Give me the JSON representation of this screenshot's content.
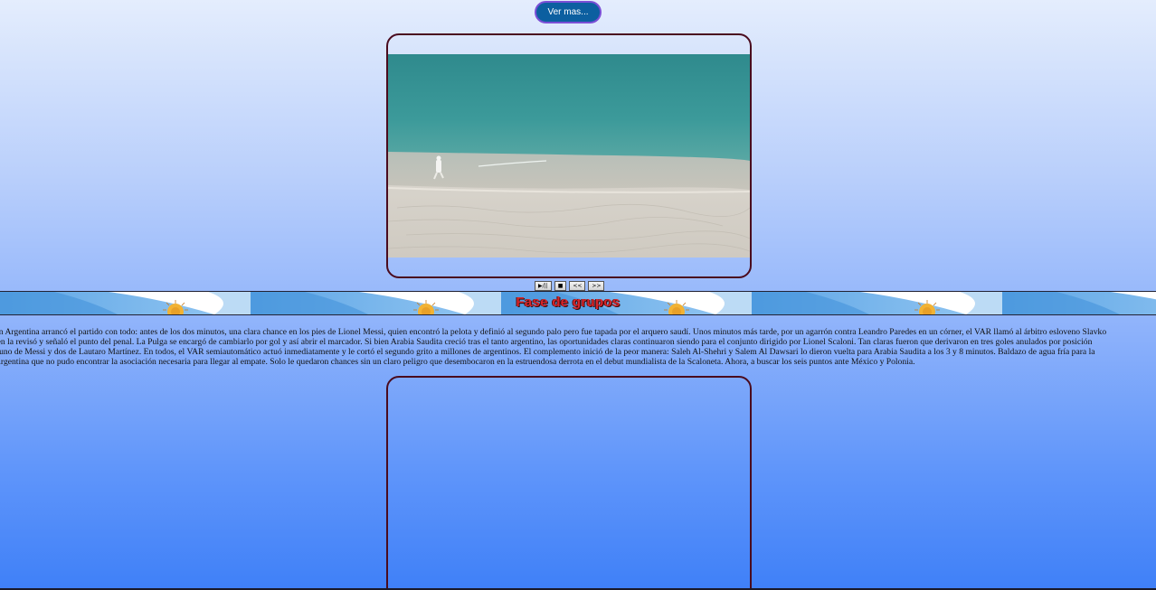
{
  "header": {
    "ver_mas_label": "Ver mas..."
  },
  "video_controls": {
    "play_pause": "▶/||",
    "stop": "■",
    "rewind": "<<",
    "forward": ">>"
  },
  "banner": {
    "title": "Fase de grupos"
  },
  "article": {
    "lines": [
      "ón Argentina arrancó el partido con todo: antes de los dos minutos, una clara chance en los pies de Lionel Messi, quien encontró la pelota y definió al segundo palo pero fue tapada por el arquero saudí. Unos minutos más tarde, por un agarrón contra Leandro Paredes en un córner, el VAR llamó al árbitro esloveno Slavko",
      "ien la revisó y señaló el punto del penal. La Pulga se encargó de cambiarlo por gol y así abrir el marcador. Si bien Arabia Saudita creció tras el tanto argentino, las oportunidades claras continuaron siendo para el conjunto dirigido por Lionel Scaloni. Tan claras fueron que derivaron en tres goles anulados por posición",
      ": uno de Messi y dos de Lautaro Martínez. En todos, el VAR semiautomático actuó inmediatamente y le cortó el segundo grito a millones de argentinos. El complemento inició de la peor manera: Saleh Al-Shehri y Salem Al Dawsari lo dieron vuelta para Arabia Saudita a los 3 y 8 minutos. Baldazo de agua fría para la",
      "Argentina que no pudo encontrar la asociación necesaria para llegar al empate. Solo le quedaron chances sin un claro peligro que desembocaron en la estruendosa derrota en el debut mundialista de la Scaloneta. Ahora, a buscar los seis puntos ante México y Polonia."
    ]
  },
  "colors": {
    "frame_border": "#4a0b1e",
    "button_bg": "#0c5fa0",
    "title_red": "#d8262b",
    "flag_blue": "#6cace4"
  }
}
